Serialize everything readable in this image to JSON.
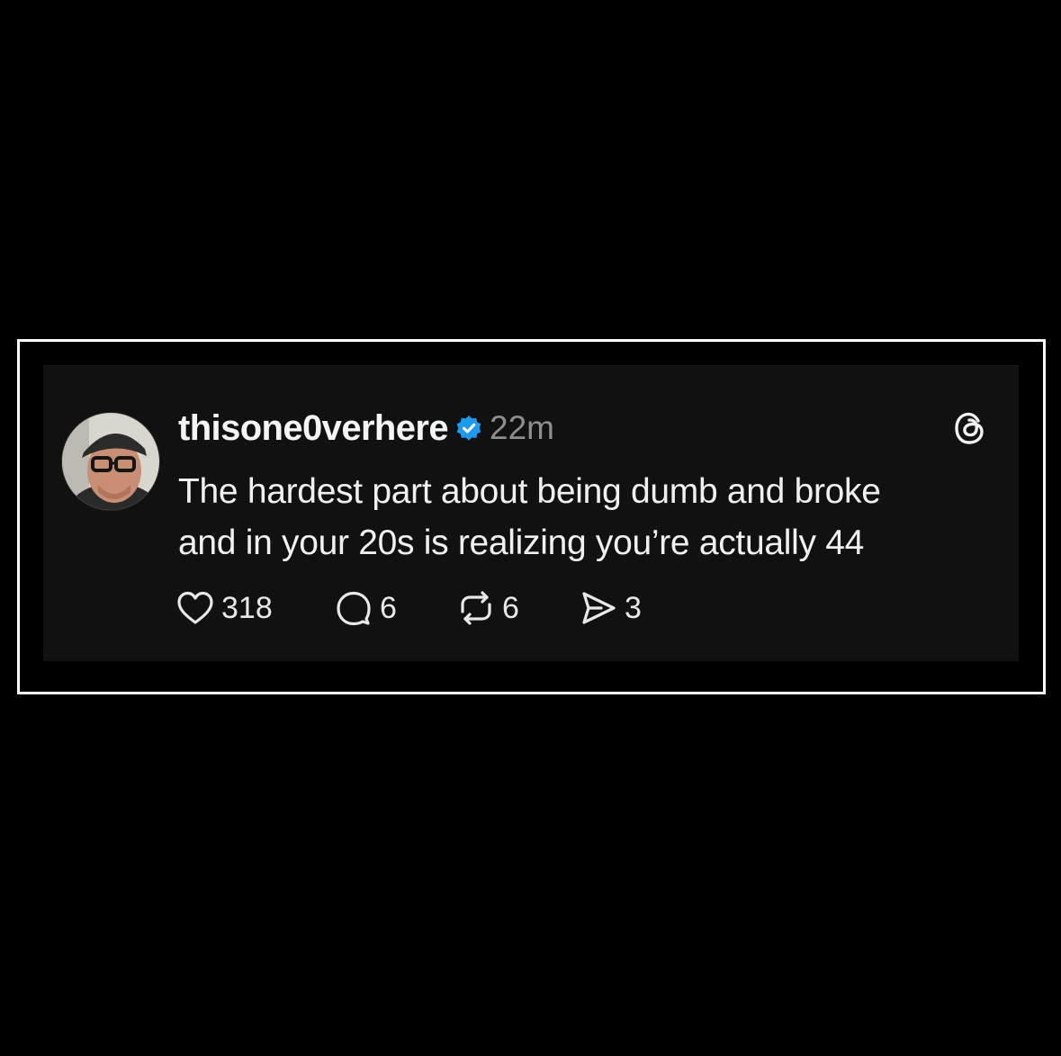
{
  "post": {
    "username": "thisone0verhere",
    "timestamp": "22m",
    "text_lines": [
      "The hardest part about being dumb and broke",
      "and in your 20s is realizing you’re actually 44"
    ],
    "actions": {
      "likes": "318",
      "replies": "6",
      "reposts": "6",
      "shares": "3"
    }
  },
  "icons": {
    "verified": "verified-badge-icon",
    "app": "threads-logo-icon",
    "like": "heart-icon",
    "reply": "speech-bubble-icon",
    "repost": "repost-arrows-icon",
    "share": "send-icon"
  },
  "colors": {
    "page_background": "#000000",
    "frame_border": "#ffffff",
    "card_background": "#111111",
    "verified_blue": "#1d9bf0",
    "timestamp_gray": "#8e8e8e"
  }
}
